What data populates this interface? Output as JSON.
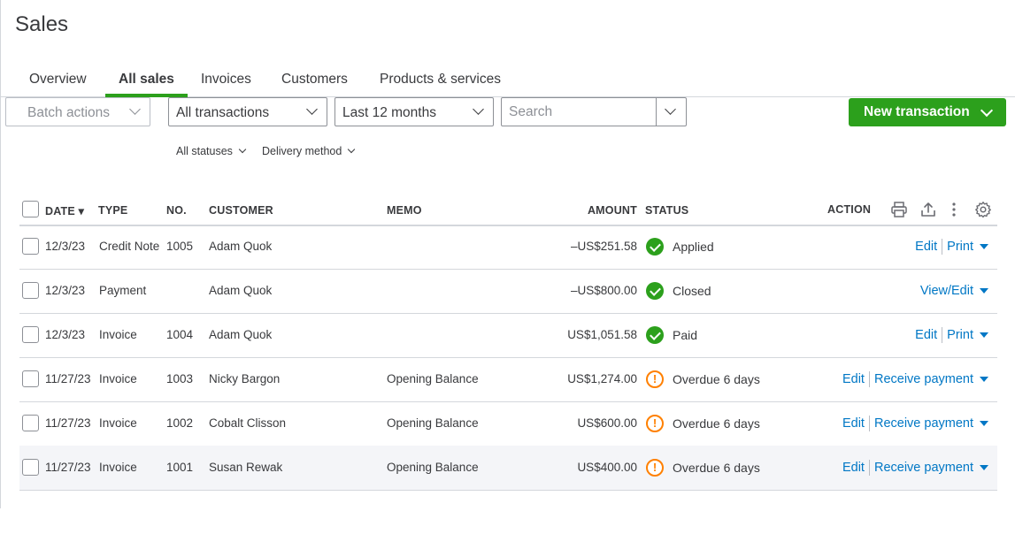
{
  "page": {
    "title": "Sales"
  },
  "tabs": [
    {
      "label": "Overview"
    },
    {
      "label": "All sales"
    },
    {
      "label": "Invoices"
    },
    {
      "label": "Customers"
    },
    {
      "label": "Products & services"
    }
  ],
  "toolbar": {
    "batch_actions": "Batch actions",
    "type_filter": "All transactions",
    "date_filter": "Last 12 months",
    "search_placeholder": "Search",
    "new_transaction": "New transaction"
  },
  "filters": {
    "statuses": "All statuses",
    "delivery": "Delivery method"
  },
  "table": {
    "headers": {
      "date": "DATE ▾",
      "type": "TYPE",
      "no": "NO.",
      "customer": "CUSTOMER",
      "memo": "MEMO",
      "amount": "AMOUNT",
      "status": "STATUS",
      "action": "ACTION"
    },
    "rows": [
      {
        "date": "12/3/23",
        "type": "Credit Note",
        "no": "1005",
        "customer": "Adam Quok",
        "memo": "",
        "amount": "–US$251.58",
        "status": "Applied",
        "status_kind": "ok",
        "actions": [
          "Edit",
          "Print"
        ]
      },
      {
        "date": "12/3/23",
        "type": "Payment",
        "no": "",
        "customer": "Adam Quok",
        "memo": "",
        "amount": "–US$800.00",
        "status": "Closed",
        "status_kind": "ok",
        "actions": [
          "View/Edit"
        ]
      },
      {
        "date": "12/3/23",
        "type": "Invoice",
        "no": "1004",
        "customer": "Adam Quok",
        "memo": "",
        "amount": "US$1,051.58",
        "status": "Paid",
        "status_kind": "ok",
        "actions": [
          "Edit",
          "Print"
        ]
      },
      {
        "date": "11/27/23",
        "type": "Invoice",
        "no": "1003",
        "customer": "Nicky Bargon",
        "memo": "Opening Balance",
        "amount": "US$1,274.00",
        "status": "Overdue 6 days",
        "status_kind": "warn",
        "actions": [
          "Edit",
          "Receive payment"
        ]
      },
      {
        "date": "11/27/23",
        "type": "Invoice",
        "no": "1002",
        "customer": "Cobalt Clisson",
        "memo": "Opening Balance",
        "amount": "US$600.00",
        "status": "Overdue 6 days",
        "status_kind": "warn",
        "actions": [
          "Edit",
          "Receive payment"
        ]
      },
      {
        "date": "11/27/23",
        "type": "Invoice",
        "no": "1001",
        "customer": "Susan Rewak",
        "memo": "Opening Balance",
        "amount": "US$400.00",
        "status": "Overdue 6 days",
        "status_kind": "warn",
        "actions": [
          "Edit",
          "Receive payment"
        ]
      }
    ]
  },
  "icons": {
    "print": "print-icon",
    "export": "export-icon",
    "more": "more-vertical-icon",
    "settings": "gear-icon",
    "status_ok": "check-circle-icon",
    "status_warn": "exclamation-circle-icon"
  },
  "colors": {
    "accent": "#2ca01c",
    "link": "#0077c5",
    "warning": "#ff8000"
  }
}
